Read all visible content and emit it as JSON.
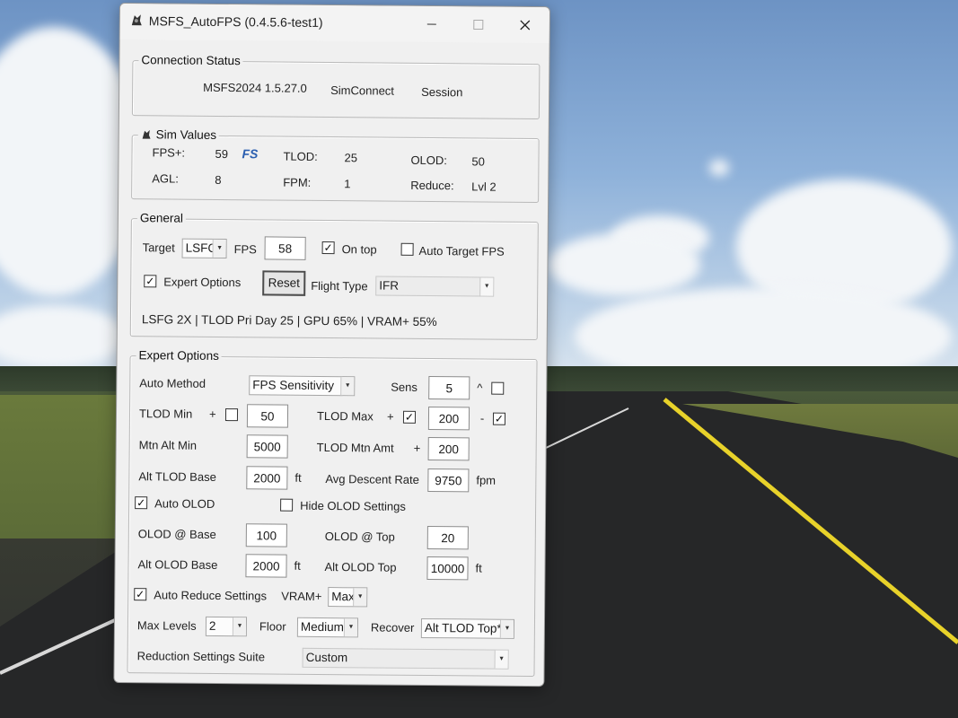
{
  "window": {
    "title": "MSFS_AutoFPS (0.4.5.6-test1)"
  },
  "connection": {
    "legend": "Connection Status",
    "sim": "MSFS2024 1.5.27.0",
    "simconnect": "SimConnect",
    "session": "Session"
  },
  "sim_values": {
    "legend": "Sim Values",
    "fps_label": "FPS+:",
    "fps_value": "59",
    "fs_badge": "FS",
    "tlod_label": "TLOD:",
    "tlod_value": "25",
    "olod_label": "OLOD:",
    "olod_value": "50",
    "agl_label": "AGL:",
    "agl_value": "8",
    "fpm_label": "FPM:",
    "fpm_value": "1",
    "reduce_label": "Reduce:",
    "reduce_value": "Lvl 2"
  },
  "general": {
    "legend": "General",
    "target_label": "Target",
    "target_select": "LSFG",
    "fps_label": "FPS",
    "fps_value": "58",
    "on_top_label": "On top",
    "on_top_checked": true,
    "auto_target_label": "Auto Target FPS",
    "auto_target_checked": false,
    "expert_label": "Expert Options",
    "expert_checked": true,
    "reset_label": "Reset",
    "flight_type_label": "Flight Type",
    "flight_type_value": "IFR",
    "status": "LSFG 2X | TLOD Pri Day 25 | GPU 65% | VRAM+ 55%"
  },
  "expert": {
    "legend": "Expert Options",
    "auto_method_label": "Auto Method",
    "auto_method_value": "FPS Sensitivity",
    "sens_label": "Sens",
    "sens_value": "5",
    "sens_caret": "^",
    "sens_checked": false,
    "tlod_min_label": "TLOD Min",
    "plus": "+",
    "minus": "-",
    "tlod_min_checked": false,
    "tlod_min_value": "50",
    "tlod_max_label": "TLOD Max",
    "tlod_max_plus_checked": true,
    "tlod_max_value": "200",
    "tlod_max_minus_checked": true,
    "mtn_alt_min_label": "Mtn Alt Min",
    "mtn_alt_min_value": "5000",
    "tlod_mtn_amt_label": "TLOD Mtn Amt",
    "tlod_mtn_amt_value": "200",
    "alt_tlod_base_label": "Alt TLOD Base",
    "alt_tlod_base_value": "2000",
    "ft": "ft",
    "avg_descent_label": "Avg Descent Rate",
    "avg_descent_value": "9750",
    "fpm": "fpm",
    "auto_olod_label": "Auto OLOD",
    "auto_olod_checked": true,
    "hide_olod_label": "Hide OLOD Settings",
    "hide_olod_checked": false,
    "olod_base_label": "OLOD @ Base",
    "olod_base_value": "100",
    "olod_top_label": "OLOD @ Top",
    "olod_top_value": "20",
    "alt_olod_base_label": "Alt OLOD Base",
    "alt_olod_base_value": "2000",
    "alt_olod_top_label": "Alt OLOD Top",
    "alt_olod_top_value": "10000",
    "auto_reduce_label": "Auto Reduce Settings",
    "auto_reduce_checked": true,
    "vram_label": "VRAM+",
    "vram_value": "Max",
    "max_levels_label": "Max Levels",
    "max_levels_value": "2",
    "floor_label": "Floor",
    "floor_value": "Medium",
    "recover_label": "Recover",
    "recover_value": "Alt TLOD Top*",
    "suite_label": "Reduction Settings Suite",
    "suite_value": "Custom"
  }
}
